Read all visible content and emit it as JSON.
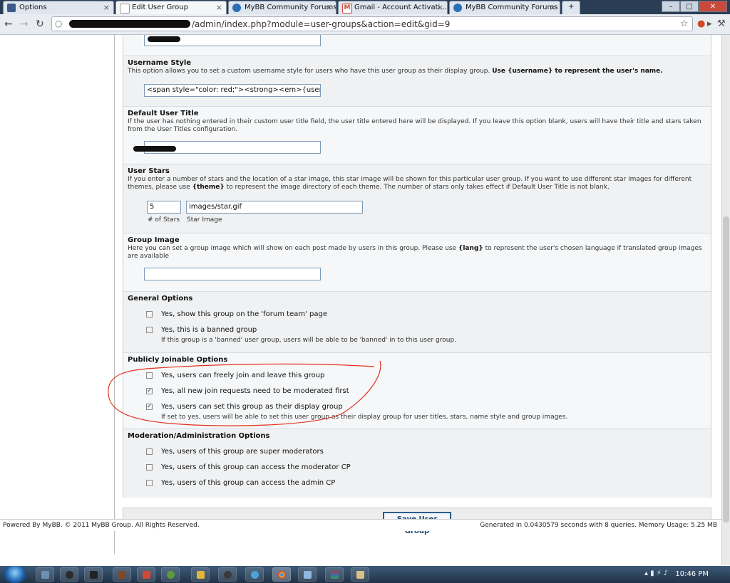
{
  "browser": {
    "tabs": [
      {
        "title": "Options",
        "color": "#3b5c8a"
      },
      {
        "title": "Edit User Group",
        "color": "#ffffff"
      },
      {
        "title": "MyBB Community Forums",
        "color": "#2c6fb5"
      },
      {
        "title": "Gmail - Account Activati...",
        "color": "#d14836"
      },
      {
        "title": "MyBB Community Forums",
        "color": "#2c6fb5"
      }
    ],
    "url": "/admin/index.php?module=user-groups&action=edit&gid=9"
  },
  "form": {
    "top_field_value": "",
    "username_style": {
      "label": "Username Style",
      "desc": "This option allows you to set a custom username style for users who have this user group as their display group.",
      "desc_bold": "Use {username} to represent the user's name.",
      "value": "<span style=\"color: red;\"><strong><em>{username"
    },
    "default_user_title": {
      "label": "Default User Title",
      "desc": "If the user has nothing entered in their custom user title field, the user title entered here will be displayed. If you leave this option blank, users will have their title and stars taken from the User Titles configuration.",
      "value": ""
    },
    "user_stars": {
      "label": "User Stars",
      "desc_1": "If you enter a number of stars and the location of a star image, this star image will be shown for this particular user group. If you want to use different star images for different themes, please use",
      "desc_token": "{theme}",
      "desc_2": "to represent the image directory of each theme. The number of stars only takes effect if Default User Title is not blank.",
      "stars_value": "5",
      "image_value": "images/star.gif",
      "stars_caption": "# of Stars",
      "image_caption": "Star Image"
    },
    "group_image": {
      "label": "Group Image",
      "desc_1": "Here you can set a group image which will show on each post made by users in this group. Please use",
      "desc_token": "{lang}",
      "desc_2": "to represent the user's chosen language if translated group images are available",
      "value": ""
    },
    "general_options": {
      "label": "General Options",
      "opt1": "Yes, show this group on the 'forum team' page",
      "opt2": "Yes, this is a banned group",
      "opt2_desc": "If this group is a 'banned' user group, users will be able to be 'banned' in to this user group."
    },
    "joinable_options": {
      "label": "Publicly Joinable Options",
      "opt1": "Yes, users can freely join and leave this group",
      "opt2": "Yes, all new join requests need to be moderated first",
      "opt3": "Yes, users can set this group as their display group",
      "opt3_desc": "If set to yes, users will be able to set this user group as their display group for user titles, stars, name style and group images."
    },
    "mod_options": {
      "label": "Moderation/Administration Options",
      "opt1": "Yes, users of this group are super moderators",
      "opt2": "Yes, users of this group can access the moderator CP",
      "opt3": "Yes, users of this group can access the admin CP"
    },
    "checked": {
      "general_1": false,
      "general_2": false,
      "joinable_1": false,
      "joinable_2": true,
      "joinable_3": true,
      "mod_1": false,
      "mod_2": false,
      "mod_3": false
    },
    "check_glyph": "✓",
    "save_label": "Save User Group"
  },
  "footer": {
    "left": "Powered By MyBB. © 2011 MyBB Group. All Rights Reserved.",
    "right": "Generated in 0.0430579 seconds with 8 queries. Memory Usage: 5.25 MB"
  },
  "taskbar": {
    "clock": "10:46 PM"
  },
  "colors": {
    "annotation": "#e0301e",
    "accent": "#2c5e8b"
  }
}
